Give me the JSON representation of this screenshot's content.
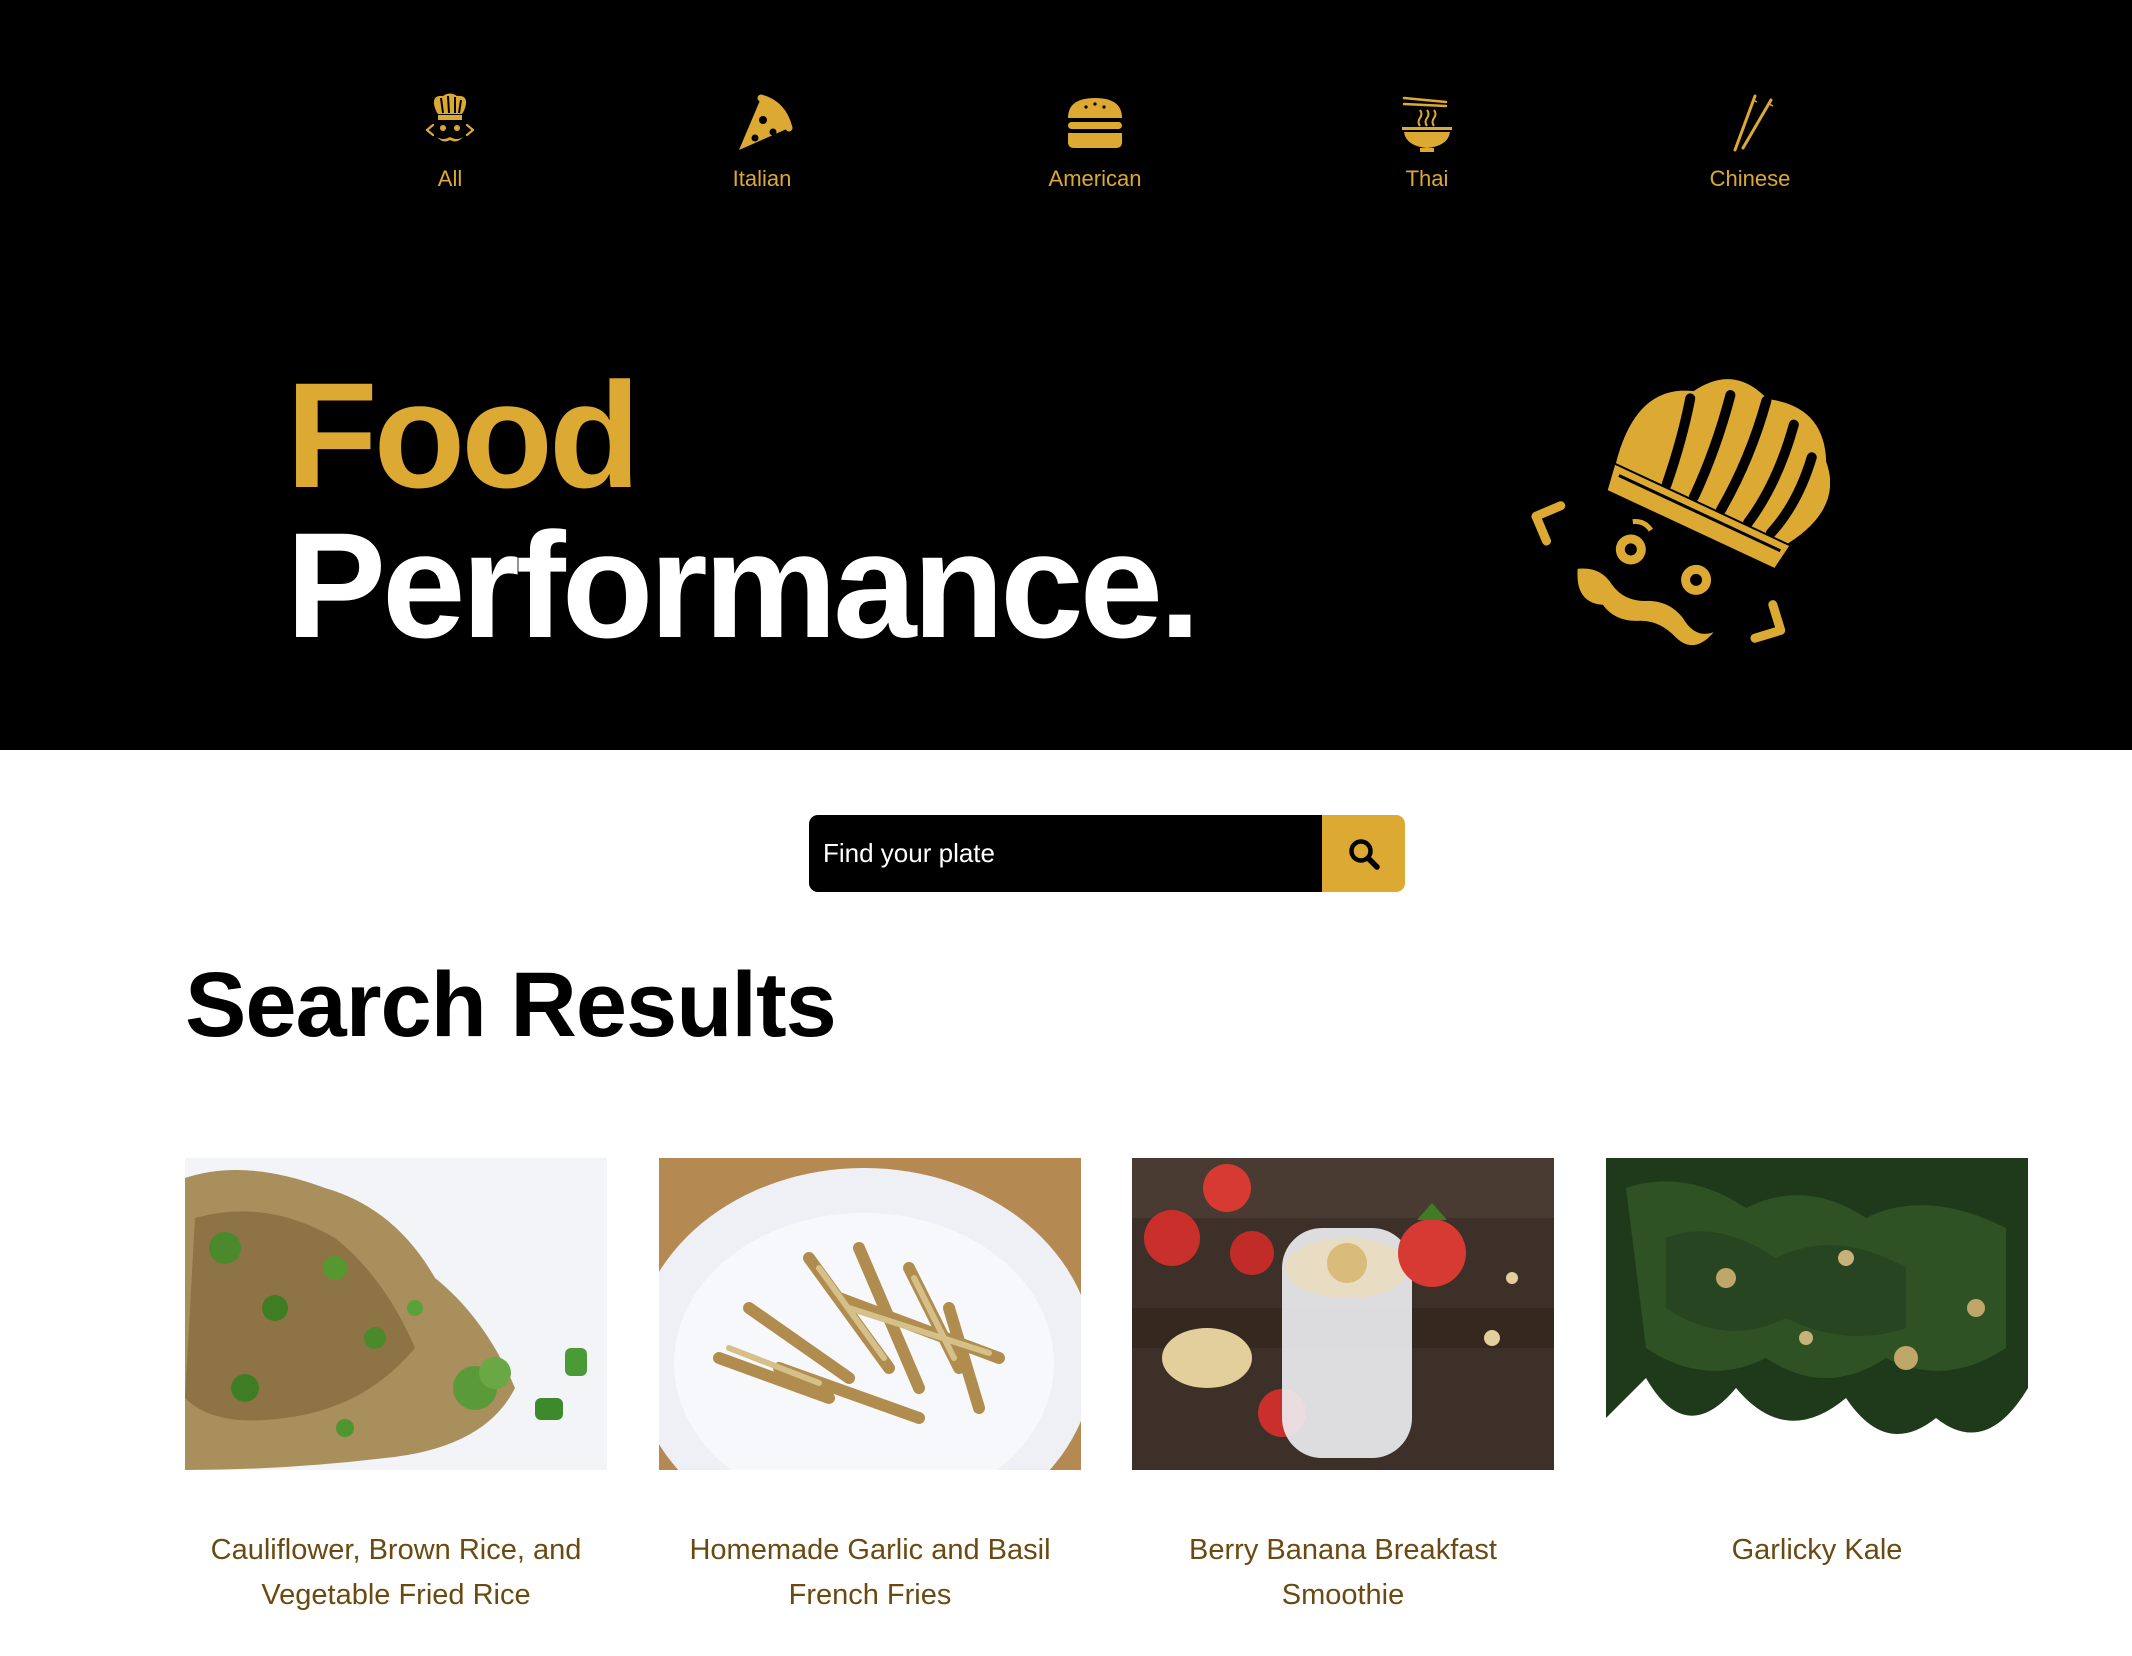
{
  "nav": {
    "categories": [
      {
        "label": "All",
        "icon": "chef-hat-icon"
      },
      {
        "label": "Italian",
        "icon": "pizza-icon"
      },
      {
        "label": "American",
        "icon": "burger-icon"
      },
      {
        "label": "Thai",
        "icon": "noodle-bowl-icon"
      },
      {
        "label": "Chinese",
        "icon": "chopsticks-icon"
      }
    ]
  },
  "hero": {
    "title_line1": "Food",
    "title_line2": "Performance.",
    "mascot_icon": "chef-hat-icon"
  },
  "search": {
    "placeholder": "Find your plate",
    "button_icon": "search-icon"
  },
  "results": {
    "heading": "Search Results",
    "items": [
      {
        "title": "Cauliflower, Brown Rice, and Vegetable Fried Rice",
        "image": "fried rice with peas and broccoli"
      },
      {
        "title": "Homemade Garlic and Basil French Fries",
        "image": "french fries on a white plate"
      },
      {
        "title": "Berry Banana Breakfast Smoothie",
        "image": "smoothie glass with strawberries"
      },
      {
        "title": "Garlicky Kale",
        "image": "sauteed kale with garlic"
      }
    ]
  },
  "colors": {
    "accent": "#dca933",
    "hero_bg": "#000000",
    "result_title": "#6b4a12"
  }
}
